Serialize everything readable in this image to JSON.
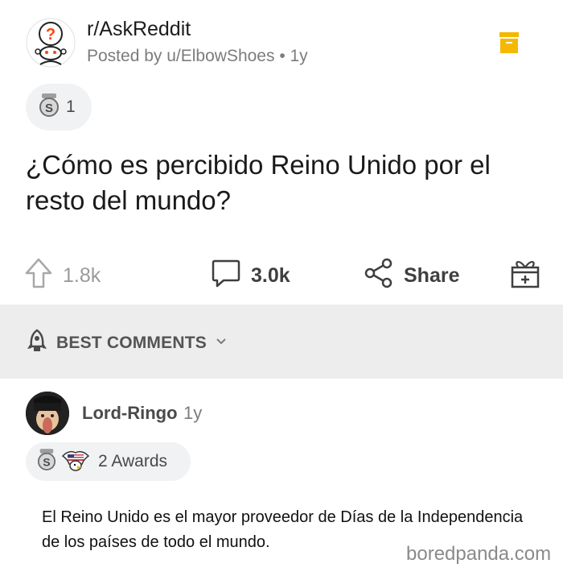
{
  "post": {
    "subreddit": "r/AskReddit",
    "posted_by": "Posted by u/ElbowShoes • 1y",
    "award_count": "1",
    "title": "¿Cómo es percibido Reino Unido por el resto del mundo?"
  },
  "actions": {
    "upvotes": "1.8k",
    "comments": "3.0k",
    "share": "Share"
  },
  "comments_section": {
    "sort_label": "BEST COMMENTS"
  },
  "comment": {
    "username": "Lord-Ringo",
    "time": "1y",
    "awards": "2 Awards",
    "body": "El Reino Unido es el mayor proveedor de Días de la Independencia de los países de todo el mundo."
  },
  "watermark": "boredpanda.com",
  "colors": {
    "save_icon": "#f5b800",
    "muted_text": "#7c7c7c",
    "section_bg": "#ededed"
  },
  "icons": [
    "subreddit-avatar-icon",
    "save-icon",
    "silver-award-icon",
    "upvote-icon",
    "comment-icon",
    "share-icon",
    "gift-icon",
    "rocket-icon",
    "chevron-down-icon",
    "eagle-award-icon"
  ]
}
